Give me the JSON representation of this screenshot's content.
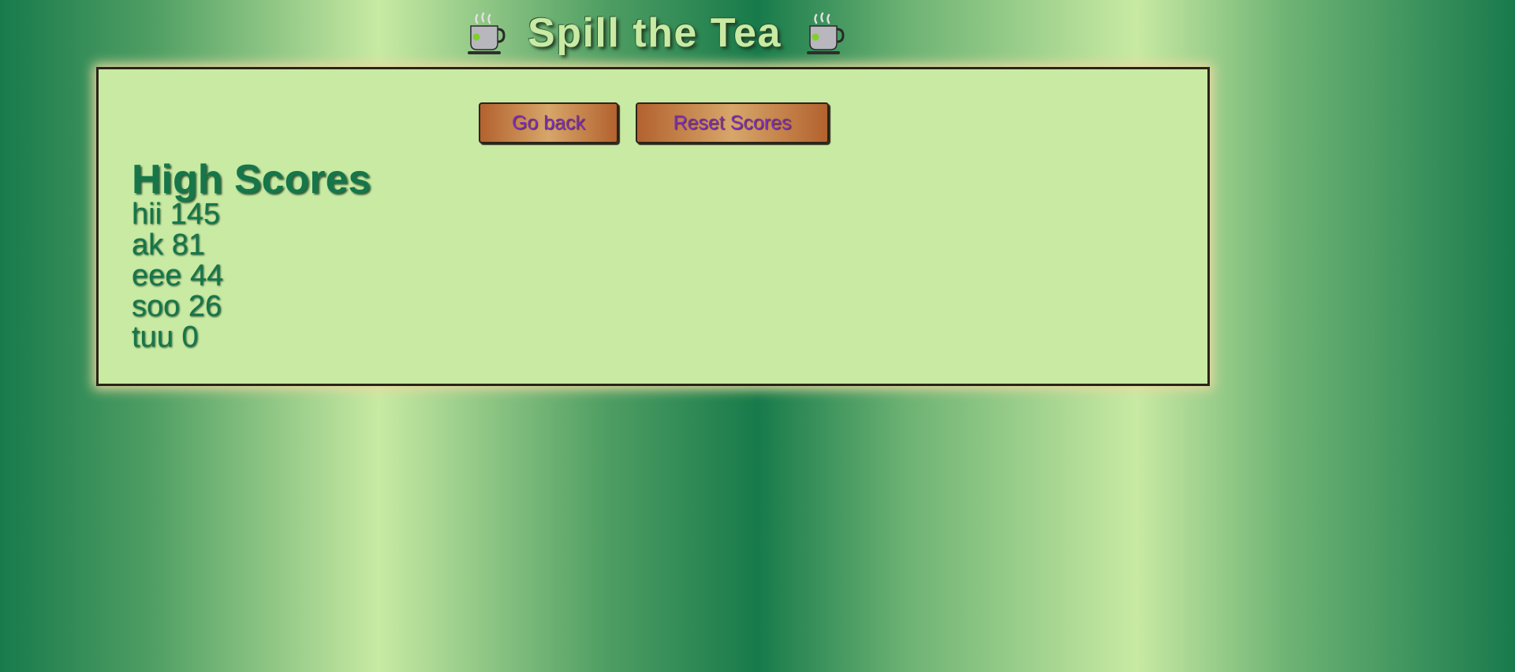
{
  "header": {
    "title": "Spill the Tea",
    "left_icon": "teacup-icon",
    "right_icon": "teacup-icon"
  },
  "toolbar": {
    "back_label": "Go back",
    "reset_label": "Reset Scores"
  },
  "scores": {
    "heading": "High Scores",
    "entries": [
      {
        "text": "hii 145"
      },
      {
        "text": "ak 81"
      },
      {
        "text": "eee 44"
      },
      {
        "text": "soo 26"
      },
      {
        "text": "tuu 0"
      }
    ]
  },
  "colors": {
    "panel_bg": "#c8eaa3",
    "text_green": "#15764a",
    "button_label": "#7a2ec2",
    "button_copper": "#b3622e"
  }
}
